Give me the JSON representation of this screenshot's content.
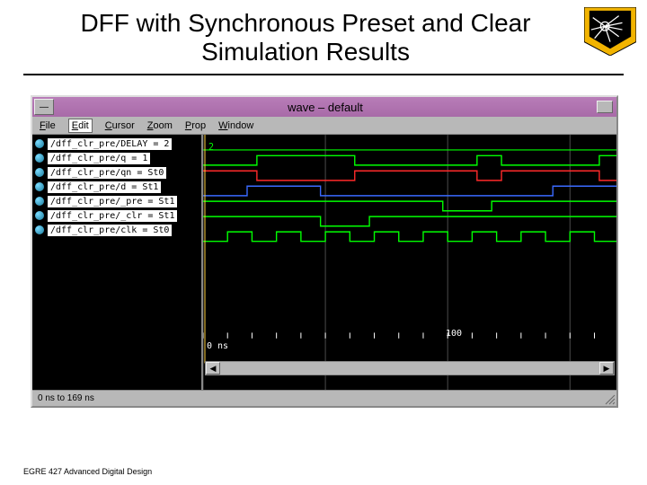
{
  "slide": {
    "title_line1": "DFF with Synchronous Preset and Clear",
    "title_line2": "Simulation Results",
    "footer": "EGRE 427 Advanced Digital Design"
  },
  "window": {
    "title": "wave – default",
    "menus": {
      "file": "File",
      "edit": "Edit",
      "cursor": "Cursor",
      "zoom": "Zoom",
      "prop": "Prop",
      "window": "Window"
    },
    "status": "0 ns to 169 ns"
  },
  "signals": [
    {
      "label": "/dff_clr_pre/DELAY = 2",
      "value_text": "2"
    },
    {
      "label": "/dff_clr_pre/q = 1"
    },
    {
      "label": "/dff_clr_pre/qn = St0"
    },
    {
      "label": "/dff_clr_pre/d = St1"
    },
    {
      "label": "/dff_clr_pre/_pre = St1"
    },
    {
      "label": "/dff_clr_pre/_clr = St1"
    },
    {
      "label": "/dff_clr_pre/clk = St0"
    }
  ],
  "timeline": {
    "cursor_label": "0 ns",
    "tick_label_100": "100"
  },
  "chart_data": {
    "type": "line",
    "note": "Digital waveform; x is time in ns (0–169), each signal is 0/1 with edge times listed",
    "x_range_ns": [
      0,
      169
    ],
    "gridlines_ns": [
      0,
      50,
      100,
      150
    ],
    "cursor_ns": 0,
    "signals": [
      {
        "name": "DELAY",
        "kind": "constant",
        "value": 2,
        "color": "#00ff00"
      },
      {
        "name": "q",
        "initial": 0,
        "edges_ns": [
          22,
          62,
          112,
          122,
          162
        ],
        "color": "#00ff00"
      },
      {
        "name": "qn",
        "initial": 1,
        "edges_ns": [
          22,
          62,
          112,
          122,
          162
        ],
        "color": "#ff2a2a"
      },
      {
        "name": "d",
        "initial": 0,
        "edges_ns": [
          18,
          48,
          143
        ],
        "color": "#3a6aff"
      },
      {
        "name": "_pre",
        "initial": 1,
        "edges_ns": [
          98,
          118
        ],
        "color": "#00ff00"
      },
      {
        "name": "_clr",
        "initial": 1,
        "edges_ns": [
          48,
          68
        ],
        "color": "#00ff00"
      },
      {
        "name": "clk",
        "initial": 0,
        "edges_ns": [
          10,
          20,
          30,
          40,
          50,
          60,
          70,
          80,
          90,
          100,
          110,
          120,
          130,
          140,
          150,
          160
        ],
        "period_ns": 20,
        "color": "#00ff00"
      }
    ]
  }
}
